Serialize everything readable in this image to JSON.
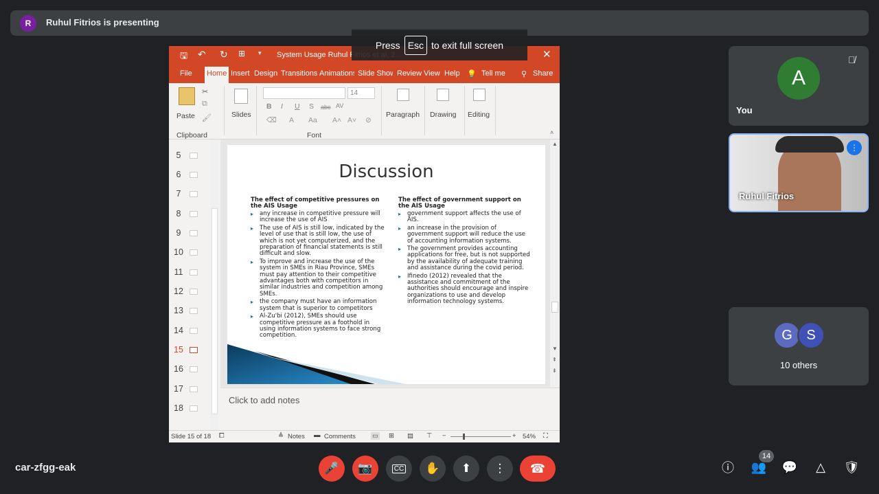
{
  "banner": {
    "avatar_letter": "R",
    "text": "Ruhul Fitrios is presenting"
  },
  "fullscreen": {
    "press": "Press",
    "key": "Esc",
    "suffix": "to exit full screen"
  },
  "ppt": {
    "title": "System Usage Ruhul Fitrios et al, 2...",
    "tabs": [
      "File",
      "Home",
      "Insert",
      "Design",
      "Transitions",
      "Animations",
      "Slide Show",
      "Review",
      "View",
      "Help"
    ],
    "tell_me": "Tell me",
    "share": "Share",
    "ribbon": {
      "paste": "Paste",
      "clipboard": "Clipboard",
      "slides": "Slides",
      "font_size": "14",
      "font_group": "Font",
      "paragraph": "Paragraph",
      "drawing": "Drawing",
      "editing": "Editing",
      "bold": "B",
      "italic": "I",
      "underline": "U",
      "shadow": "S",
      "strike": "abc",
      "spacing": "AV"
    },
    "thumbnails": [
      "5",
      "6",
      "7",
      "8",
      "9",
      "10",
      "11",
      "12",
      "13",
      "14",
      "15",
      "16",
      "17",
      "18"
    ],
    "selected_slide": "15",
    "slide": {
      "title": "Discussion",
      "left_heading": "The effect of competitive pressures on the AIS Usage",
      "left_bullets": [
        "any increase in competitive pressure will increase the use of AIS",
        "The use of AIS is still low, indicated by the level of use that is still low, the use of which is not yet computerized, and the preparation of financial statements is still difficult and slow.",
        "To improve and increase the use of the system in SMEs in Riau Province, SMEs must pay attention to their competitive advantages both with competitors in similar industries and competition among SMEs.",
        "the company must have an information system that is superior to competitors",
        "Al-Zu'bi (2012), SMEs should use competitive pressure as a foothold in using information systems to face strong competition."
      ],
      "right_heading": "The effect of government support on the AIS Usage",
      "right_bullets": [
        "government support affects the use of AIS.",
        "an increase in the provision of government support will reduce the use of accounting information systems.",
        "The government provides accounting applications for free, but is not supported by the availability of adequate training and assistance during the covid period.",
        "Ifinedo (2012) revealed that the assistance and commitment of the authorities should encourage and inspire organizations to use and develop information technology systems."
      ]
    },
    "notes_placeholder": "Click to add notes",
    "status": {
      "slide_of": "Slide 15 of 18",
      "notes": "Notes",
      "comments": "Comments",
      "zoom": "54%"
    }
  },
  "participants": {
    "you": {
      "letter": "A",
      "name": "You"
    },
    "presenter": {
      "name": "Ruhul Fitrios"
    },
    "others": {
      "letters": [
        "G",
        "S"
      ],
      "label": "10 others"
    }
  },
  "bottom": {
    "meeting_code": "car-zfgg-eak",
    "people_count": "14"
  },
  "colors": {
    "ppt_accent": "#d24726",
    "end_call": "#ea4335",
    "avatar_you": "#2e7d32",
    "avatar_g": "#5c6bc0",
    "avatar_s": "#3f51b5"
  }
}
